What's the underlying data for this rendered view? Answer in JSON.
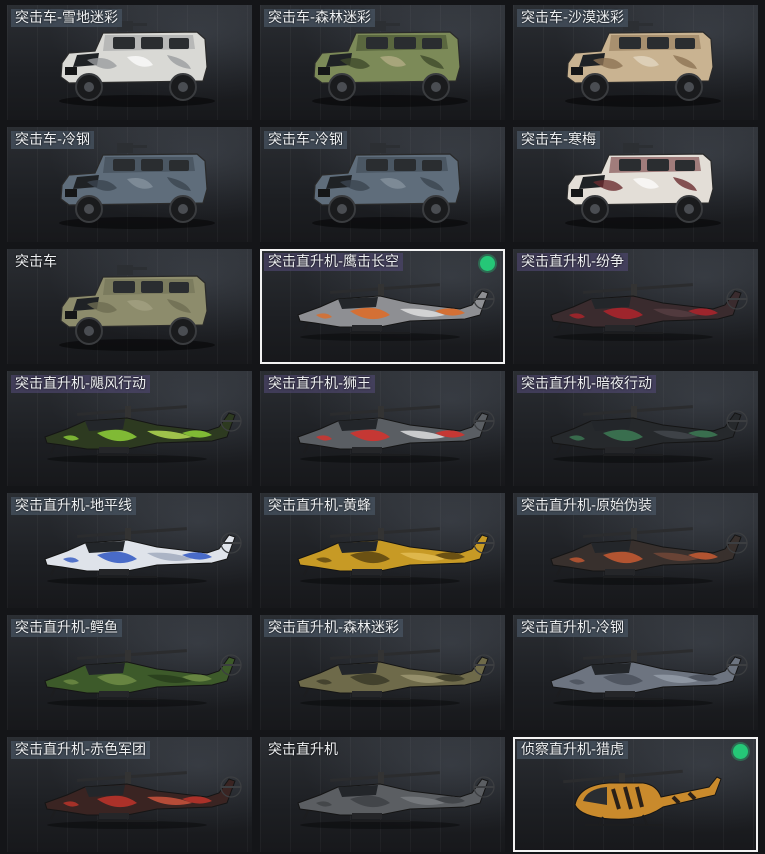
{
  "vehicles": [
    {
      "name": "突击车-雪地迷彩",
      "kind": "truck",
      "base": "#d9d9d5",
      "camo": "#9a9c9f",
      "camo2": "#ffffff",
      "tag": "hl",
      "selected": false
    },
    {
      "name": "突击车-森林迷彩",
      "kind": "truck",
      "base": "#7c8a58",
      "camo": "#3e4a2c",
      "camo2": "#b9b08a",
      "tag": "hl",
      "selected": false
    },
    {
      "name": "突击车-沙漠迷彩",
      "kind": "truck",
      "base": "#c9b391",
      "camo": "#8d7354",
      "camo2": "#e6dbc7",
      "tag": "hl",
      "selected": false
    },
    {
      "name": "突击车-冷钢",
      "kind": "truck",
      "base": "#5f6d7b",
      "camo": "#3b4550",
      "camo2": "#8a97a3",
      "tag": "hl",
      "selected": false
    },
    {
      "name": "突击车-冷钢",
      "kind": "truck",
      "base": "#5f6d7b",
      "camo": "#3b4550",
      "camo2": "#8a97a3",
      "tag": "hl",
      "selected": false
    },
    {
      "name": "突击车-寒梅",
      "kind": "truck",
      "base": "#e3ded7",
      "camo": "#6a2c30",
      "camo2": "#ffffff",
      "tag": "hl",
      "selected": false
    },
    {
      "name": "突击车",
      "kind": "truck",
      "base": "#8d8c6c",
      "camo": "#6e6d53",
      "camo2": "#a5a384",
      "tag": "none",
      "selected": false
    },
    {
      "name": "突击直升机-鹰击长空",
      "kind": "heli",
      "base": "#8e8f93",
      "camo": "#e06b25",
      "camo2": "#e8e8e8",
      "tag": "hl hel",
      "selected": true
    },
    {
      "name": "突击直升机-纷争",
      "kind": "heli",
      "base": "#3a2b2e",
      "camo": "#b0242b",
      "camo2": "#5a4044",
      "tag": "hl hel",
      "selected": false
    },
    {
      "name": "突击直升机-飓风行动",
      "kind": "heli",
      "base": "#2d3a20",
      "camo": "#8fd13a",
      "camo2": "#c5f05a",
      "tag": "hl hel",
      "selected": false
    },
    {
      "name": "突击直升机-狮王",
      "kind": "heli",
      "base": "#5a5e63",
      "camo": "#d8312b",
      "camo2": "#f0f0f0",
      "tag": "hl hel",
      "selected": false
    },
    {
      "name": "突击直升机-暗夜行动",
      "kind": "heli",
      "base": "#26292c",
      "camo": "#3d7a55",
      "camo2": "#474b50",
      "tag": "hl hel",
      "selected": false
    },
    {
      "name": "突击直升机-地平线",
      "kind": "heli",
      "base": "#dfe3ea",
      "camo": "#2f56c2",
      "camo2": "#9aa4b8",
      "tag": "hl",
      "selected": false
    },
    {
      "name": "突击直升机-黄蜂",
      "kind": "heli",
      "base": "#c79a25",
      "camo": "#5a4410",
      "camo2": "#e6c05a",
      "tag": "hl",
      "selected": false
    },
    {
      "name": "突击直升机-原始伪装",
      "kind": "heli",
      "base": "#38302d",
      "camo": "#c85a32",
      "camo2": "#7a4a38",
      "tag": "hl",
      "selected": false
    },
    {
      "name": "突击直升机-鳄鱼",
      "kind": "heli",
      "base": "#3d5a2a",
      "camo": "#6f8c45",
      "camo2": "#263b1b",
      "tag": "hl",
      "selected": false
    },
    {
      "name": "突击直升机-森林迷彩",
      "kind": "heli",
      "base": "#6e6a4a",
      "camo": "#3b3a28",
      "camo2": "#a49e78",
      "tag": "hl",
      "selected": false
    },
    {
      "name": "突击直升机-冷钢",
      "kind": "heli",
      "base": "#6d7480",
      "camo": "#4a505a",
      "camo2": "#9aa2ae",
      "tag": "hl",
      "selected": false
    },
    {
      "name": "突击直升机-赤色军团",
      "kind": "heli",
      "base": "#3a2422",
      "camo": "#c0342a",
      "camo2": "#e05a40",
      "tag": "hl",
      "selected": false
    },
    {
      "name": "突击直升机",
      "kind": "heli",
      "base": "#5b5e62",
      "camo": "#3e4145",
      "camo2": "#7d8186",
      "tag": "none",
      "selected": false
    },
    {
      "name": "侦察直升机-猎虎",
      "kind": "scout",
      "base": "#c98a2c",
      "camo": "#2a2018",
      "camo2": "#e0a548",
      "tag": "hl",
      "selected": true
    }
  ]
}
